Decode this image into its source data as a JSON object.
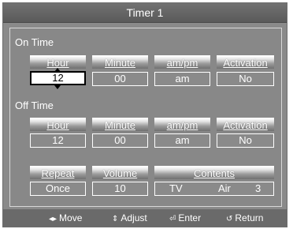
{
  "title": "Timer 1",
  "on_time": {
    "label": "On Time",
    "headers": [
      "Hour",
      "Minute",
      "am/pm",
      "Activation"
    ],
    "values": [
      "12",
      "00",
      "am",
      "No"
    ]
  },
  "off_time": {
    "label": "Off Time",
    "headers": [
      "Hour",
      "Minute",
      "am/pm",
      "Activation"
    ],
    "values": [
      "12",
      "00",
      "am",
      "No"
    ]
  },
  "extra": {
    "headers": {
      "repeat": "Repeat",
      "volume": "Volume",
      "contents": "Contents"
    },
    "values": {
      "repeat": "Once",
      "volume": "10",
      "source": "TV",
      "antenna": "Air",
      "channel": "3"
    }
  },
  "footer": {
    "move": {
      "icon": "left-right-arrows-icon",
      "label": "Move"
    },
    "adjust": {
      "icon": "up-down-arrows-icon",
      "label": "Adjust"
    },
    "enter": {
      "icon": "enter-icon",
      "label": "Enter"
    },
    "return": {
      "icon": "return-icon",
      "label": "Return"
    }
  }
}
